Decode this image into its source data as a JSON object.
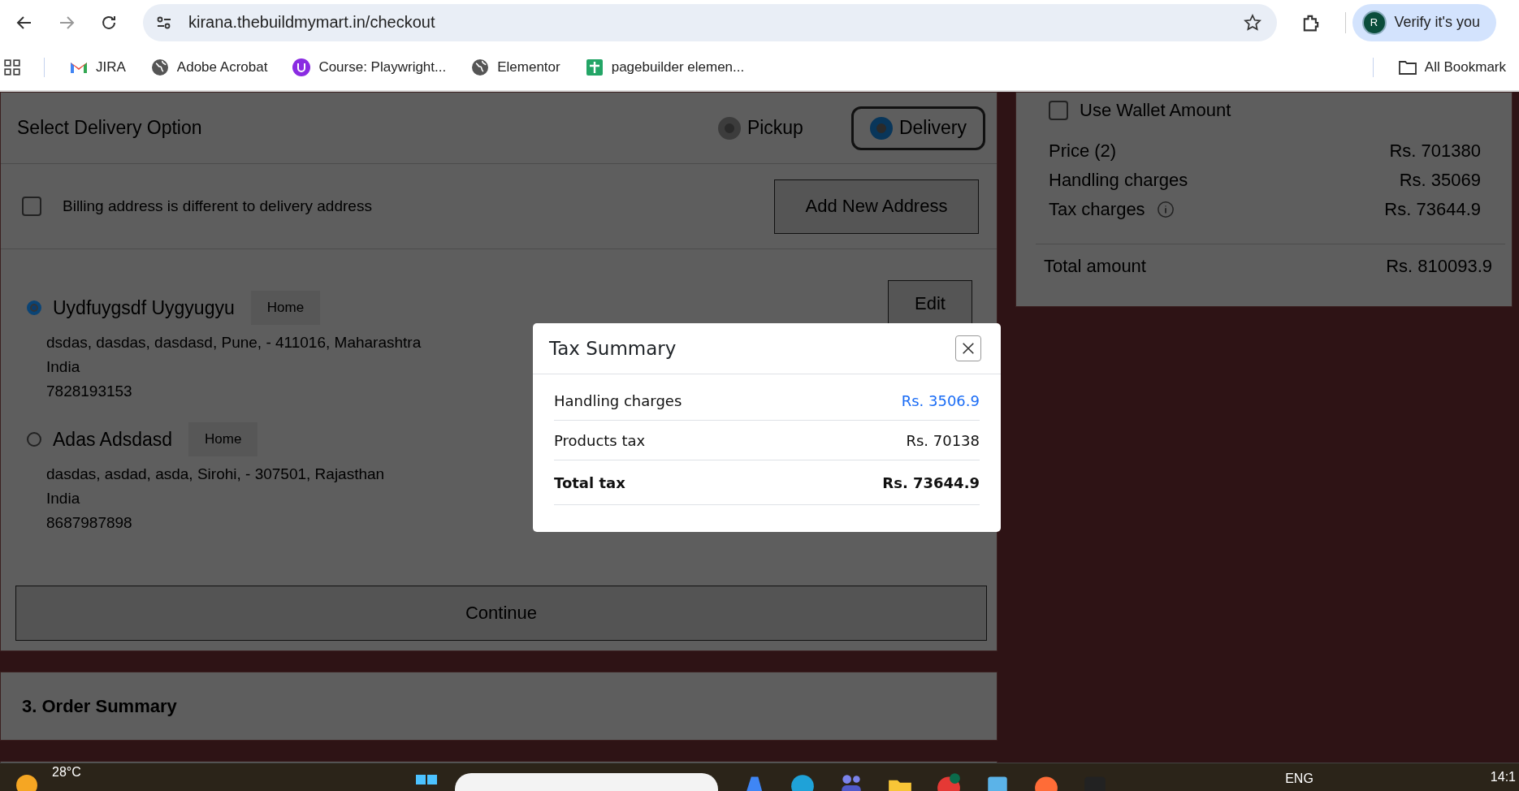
{
  "browser": {
    "url": "kirana.thebuildmymart.in/checkout",
    "profile_button": "Verify it's you",
    "profile_initial": "R",
    "bookmarks": [
      {
        "label": "JIRA",
        "kind": "mail"
      },
      {
        "label": "Adobe Acrobat",
        "kind": "globe"
      },
      {
        "label": "Course: Playwright...",
        "kind": "badge"
      },
      {
        "label": "Elementor",
        "kind": "globe"
      },
      {
        "label": "pagebuilder elemen...",
        "kind": "sheet"
      }
    ],
    "all_bookmarks": "All Bookmark"
  },
  "delivery": {
    "title": "Select Delivery Option",
    "options": [
      {
        "label": "Pickup",
        "selected": false
      },
      {
        "label": "Delivery",
        "selected": true
      }
    ],
    "billing": {
      "label": "Billing address is different to delivery address",
      "checked": false
    },
    "add_button": "Add New Address",
    "addresses": [
      {
        "name": "Uydfuygsdf Uygyugyu",
        "tag": "Home",
        "lines": [
          "dsdas, dasdas, dasdasd, Pune, - 411016, Maharashtra",
          "India",
          "7828193153"
        ],
        "selected": true,
        "edit": "Edit"
      },
      {
        "name": "Adas Adsdasd",
        "tag": "Home",
        "lines": [
          "dasdas, asdad, asda, Sirohi, - 307501, Rajasthan",
          "India",
          "8687987898"
        ],
        "selected": false
      }
    ],
    "continue_button": "Continue"
  },
  "order_summary": {
    "title": "3. Order Summary"
  },
  "price_panel": {
    "wallet": {
      "label": "Use Wallet Amount",
      "checked": false
    },
    "rows": [
      {
        "label": "Price (2)",
        "value": "Rs. 701380",
        "info": false
      },
      {
        "label": "Handling charges",
        "value": "Rs. 35069",
        "info": false
      },
      {
        "label": "Tax charges",
        "value": "Rs. 73644.9",
        "info": true
      }
    ],
    "total": {
      "label": "Total amount",
      "value": "Rs. 810093.9"
    }
  },
  "modal": {
    "title": "Tax Summary",
    "rows": [
      {
        "label": "Handling charges",
        "value": "Rs. 3506.9",
        "kind": "link"
      },
      {
        "label": "Products tax",
        "value": "Rs. 70138",
        "kind": "plain"
      },
      {
        "label": "Total tax",
        "value": "Rs. 73644.9",
        "kind": "total"
      }
    ]
  },
  "taskbar": {
    "weather": "28°C",
    "language": "ENG",
    "time": "14:1"
  }
}
